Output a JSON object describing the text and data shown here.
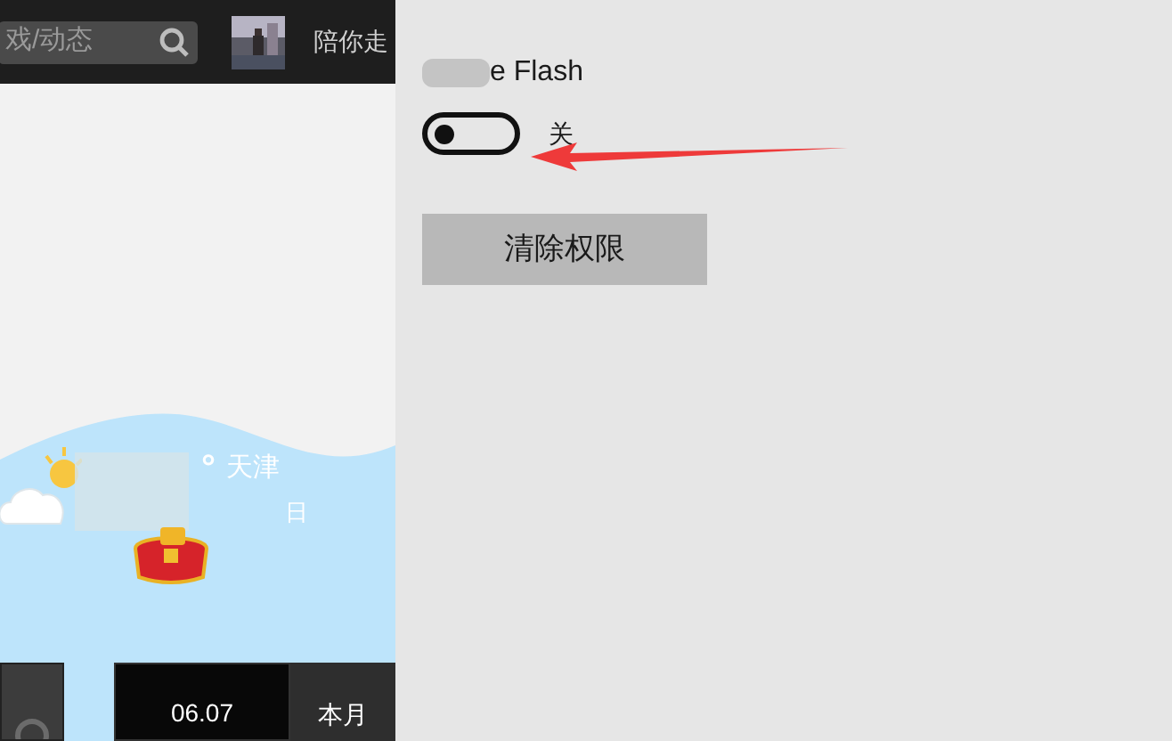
{
  "search": {
    "placeholder": "戏/动态"
  },
  "user": {
    "name": "陪你走"
  },
  "weather": {
    "temperature": "°",
    "city": "天津",
    "note": "日"
  },
  "tabs": [
    {
      "label": "06.07",
      "selected": true
    },
    {
      "label": "本月",
      "selected": false
    }
  ],
  "settings": {
    "title": "e Flash",
    "toggle": {
      "label": "关",
      "on": false
    },
    "button": "清除权限"
  }
}
